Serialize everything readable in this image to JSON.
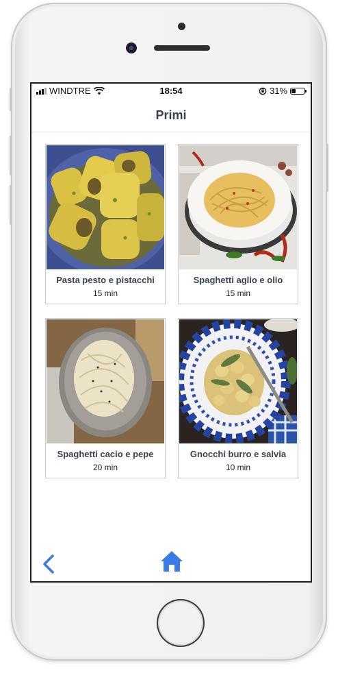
{
  "status_bar": {
    "carrier": "WINDTRE",
    "time": "18:54",
    "battery_percent": "31%",
    "battery_level": 0.31,
    "icons": [
      "signal-icon",
      "wifi-icon",
      "orientation-lock-icon",
      "battery-icon"
    ]
  },
  "page": {
    "title": "Primi"
  },
  "recipes": [
    {
      "name": "Pasta pesto e pistacchi",
      "time": "15 min",
      "image": "paccheri-pesto-photo"
    },
    {
      "name": "Spaghetti aglio e olio",
      "time": "15 min",
      "image": "spaghetti-aglio-photo"
    },
    {
      "name": "Spaghetti cacio e pepe",
      "time": "20 min",
      "image": "spaghetti-cacio-photo"
    },
    {
      "name": "Gnocchi burro e salvia",
      "time": "10 min",
      "image": "gnocchi-salvia-photo"
    }
  ],
  "nav": {
    "icons": [
      "back-chevron-icon",
      "home-icon"
    ]
  },
  "colors": {
    "accent": "#3b7be8",
    "text": "#3a4250",
    "card_border": "#c4c9d6"
  }
}
